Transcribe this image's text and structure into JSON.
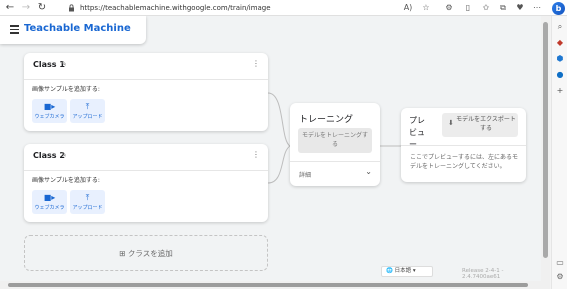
{
  "browser": {
    "url": "https://teachablemachine.withgoogle.com/train/image"
  },
  "header": {
    "title": "Teachable Machine"
  },
  "classes": [
    {
      "name": "Class 1",
      "add_samples_label": "画像サンプルを追加する:",
      "webcam_label": "ウェブカメラ",
      "upload_label": "アップロード"
    },
    {
      "name": "Class 2",
      "add_samples_label": "画像サンプルを追加する:",
      "webcam_label": "ウェブカメラ",
      "upload_label": "アップロード"
    }
  ],
  "add_class": {
    "label": "クラスを追加"
  },
  "training": {
    "title": "トレーニング",
    "train_button": "モデルをトレーニングする",
    "advanced_label": "詳細"
  },
  "preview": {
    "title": "プレビュー",
    "export_button": "モデルをエクスポートする",
    "message": "ここでプレビューするには、左にあるモデルをトレーニングしてください。"
  },
  "footer": {
    "language": "日本語",
    "version": "Release 2-4-1 - 2.4.7400ae61"
  },
  "colors": {
    "brand_blue": "#1967d2",
    "button_tint": "#e8f0fe"
  }
}
